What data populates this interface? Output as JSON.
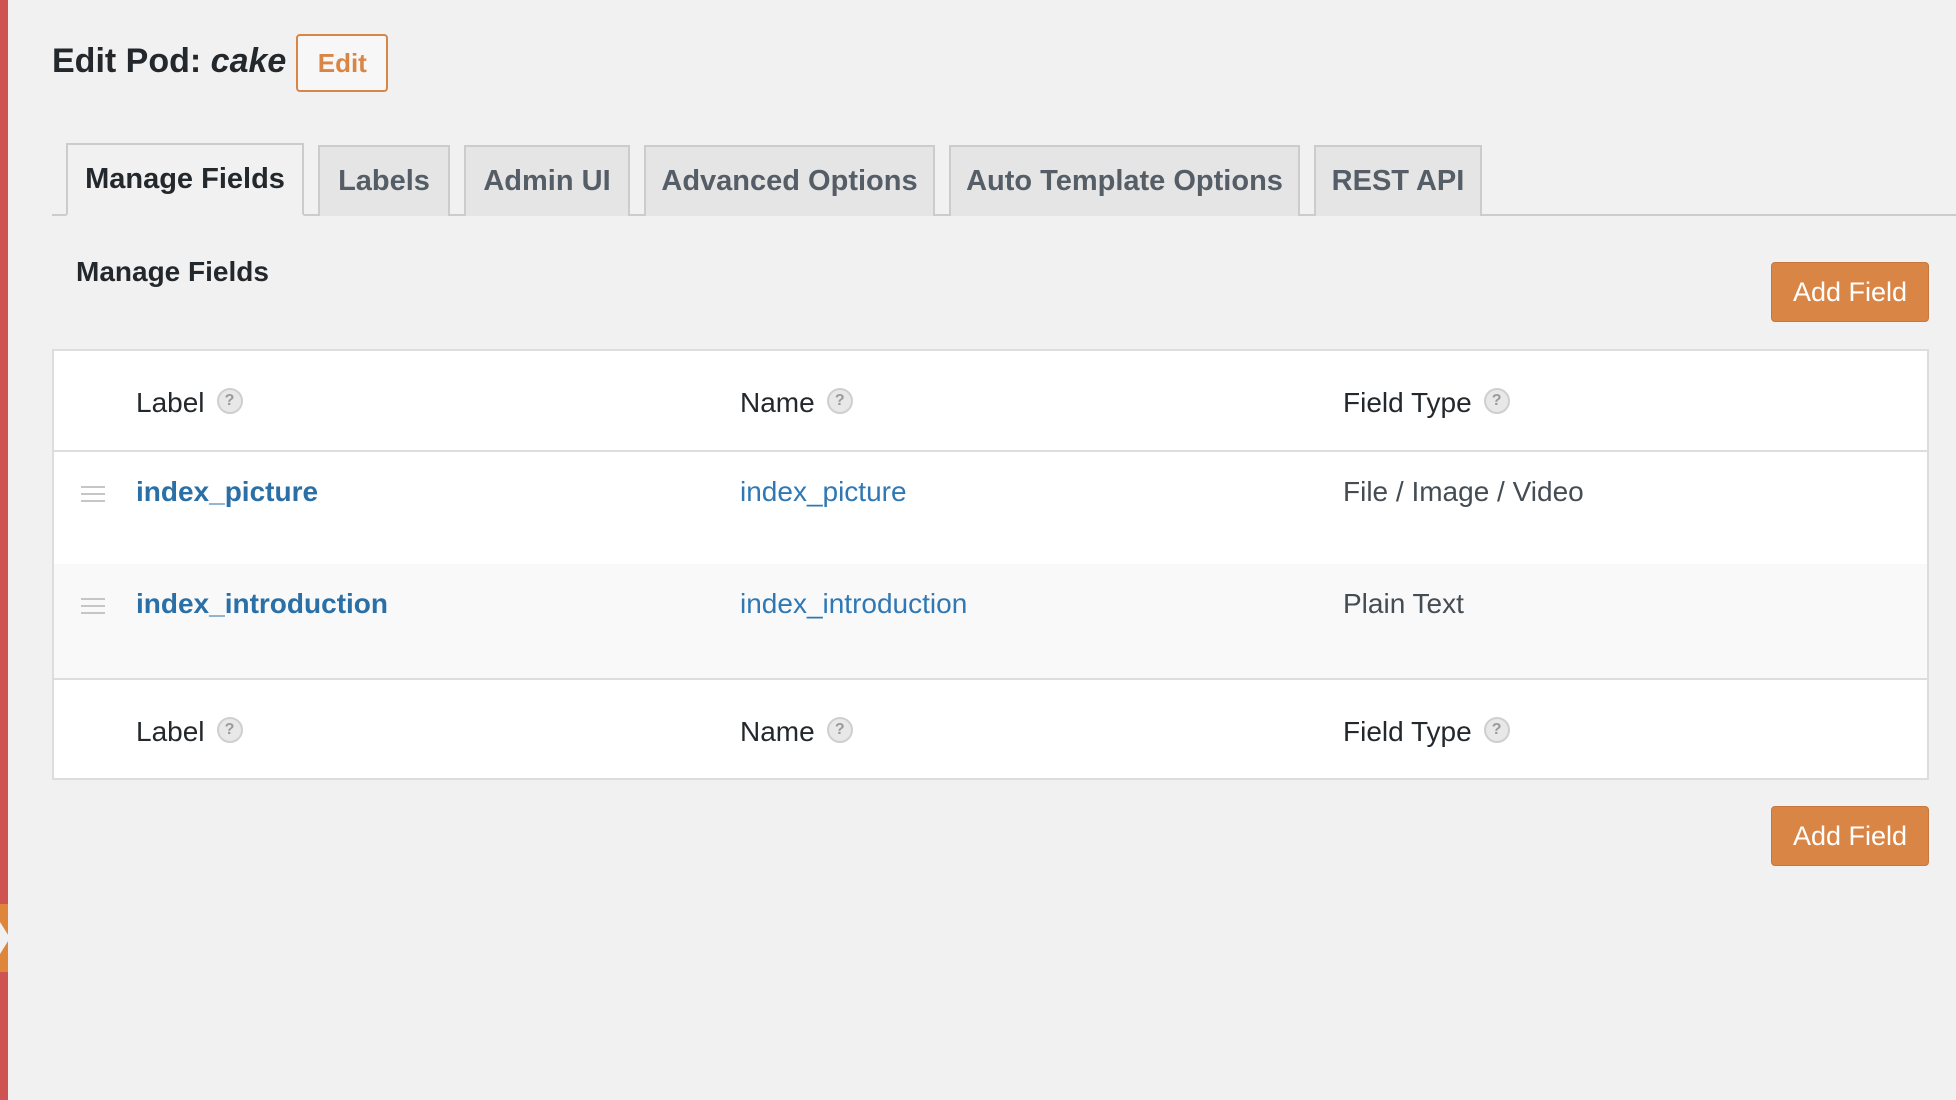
{
  "header": {
    "title_prefix": "Edit Pod: ",
    "pod_name": "cake",
    "edit_label": "Edit"
  },
  "tabs": [
    {
      "label": "Manage Fields",
      "active": true
    },
    {
      "label": "Labels",
      "active": false
    },
    {
      "label": "Admin UI",
      "active": false
    },
    {
      "label": "Advanced Options",
      "active": false
    },
    {
      "label": "Auto Template Options",
      "active": false
    },
    {
      "label": "REST API",
      "active": false
    }
  ],
  "section": {
    "title": "Manage Fields",
    "add_field_label": "Add Field"
  },
  "table": {
    "columns": {
      "label": "Label",
      "name": "Name",
      "type": "Field Type"
    },
    "help_glyph": "?",
    "rows": [
      {
        "label": "index_picture",
        "name": "index_picture",
        "type": "File / Image / Video"
      },
      {
        "label": "index_introduction",
        "name": "index_introduction",
        "type": "Plain Text"
      }
    ]
  },
  "colors": {
    "accent": "#d98545",
    "link": "#2a6fa6",
    "admin_strip": "#cf5350"
  }
}
